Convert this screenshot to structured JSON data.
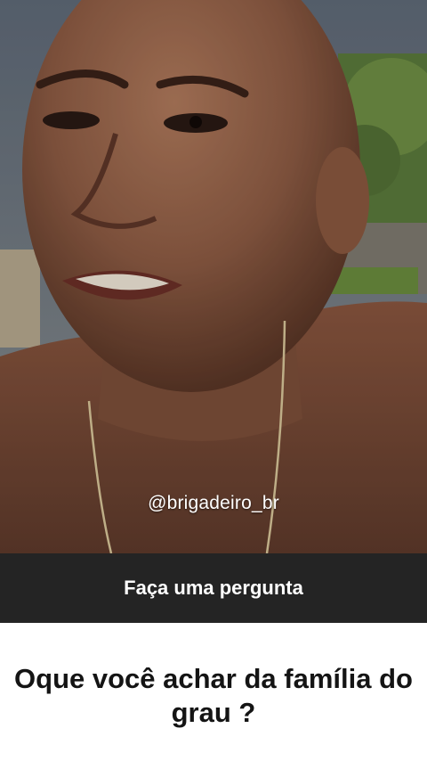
{
  "video": {
    "watermark": "@brigadeiro_br"
  },
  "sticker": {
    "header": "Faça uma pergunta",
    "question": "Oque você achar da família do grau ?"
  },
  "colors": {
    "header_bg": "#242424",
    "body_bg": "#ffffff",
    "text_dark": "#141414"
  }
}
